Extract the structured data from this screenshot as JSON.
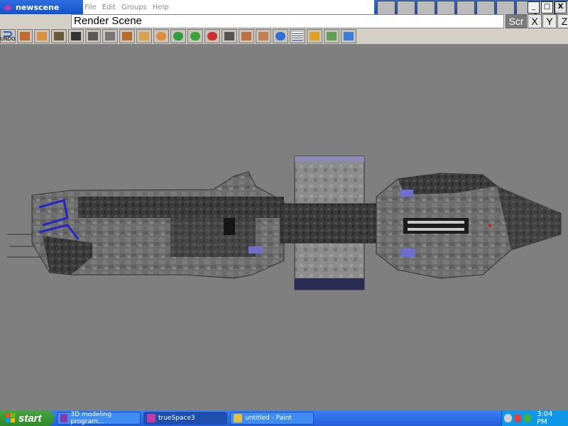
{
  "window": {
    "title": "newscene",
    "menu": [
      "File",
      "Edit",
      "Groups",
      "Help"
    ],
    "controls": {
      "minimize": "_",
      "restore": "□",
      "close": "X"
    }
  },
  "scene": {
    "label": "Render Scene",
    "view_buttons": [
      "Scr",
      "X",
      "Y",
      "Z"
    ]
  },
  "toolbar": {
    "undo_label": "UNDO",
    "tools": [
      {
        "name": "undo-icon",
        "color": "#1f5fc0"
      },
      {
        "name": "object-tool-icon",
        "color": "#c46a2f"
      },
      {
        "name": "primitive-cube-icon",
        "color": "#d9913f"
      },
      {
        "name": "paint-tool-icon",
        "color": "#6b5a3a"
      },
      {
        "name": "pointer-arrow-icon",
        "color": "#333333"
      },
      {
        "name": "rotate-icon",
        "color": "#5a5a5a"
      },
      {
        "name": "up-level-icon",
        "color": "#777777"
      },
      {
        "name": "box-icon",
        "color": "#b86b2d"
      },
      {
        "name": "wedge-icon",
        "color": "#d8a24a"
      },
      {
        "name": "sphere-icon",
        "color": "#e08b3a"
      },
      {
        "name": "material-sphere-icon",
        "color": "#2f9b3a"
      },
      {
        "name": "morph-icon",
        "color": "#3ea13a"
      },
      {
        "name": "light-icon",
        "color": "#d03030"
      },
      {
        "name": "path-icon",
        "color": "#555555"
      },
      {
        "name": "pencil-icon",
        "color": "#c07040"
      },
      {
        "name": "brush-icon",
        "color": "#c08050"
      },
      {
        "name": "color-balls-icon",
        "color": "#3070d0"
      },
      {
        "name": "grid-icon",
        "color": "#3040c0"
      },
      {
        "name": "star-burst-icon",
        "color": "#e0a020"
      },
      {
        "name": "texture-map-icon",
        "color": "#60a050"
      },
      {
        "name": "3d-render-icon",
        "color": "#3a80d8"
      }
    ]
  },
  "quick_tools": [
    "vehicle-preset-icon",
    "wave-icon",
    "panel-icon",
    "curve-icon",
    "plane-icon",
    "grid-preset-icon",
    "bucket-icon",
    "house-icon",
    "frame-icon",
    "rainbow-icon",
    "question-icon"
  ],
  "taskbar": {
    "start_label": "start",
    "tasks": [
      {
        "label": "3D modeling program...",
        "active": false
      },
      {
        "label": "trueSpace3",
        "active": true
      },
      {
        "label": "untitled - Paint",
        "active": false
      }
    ],
    "clock": "3:04 PM"
  }
}
